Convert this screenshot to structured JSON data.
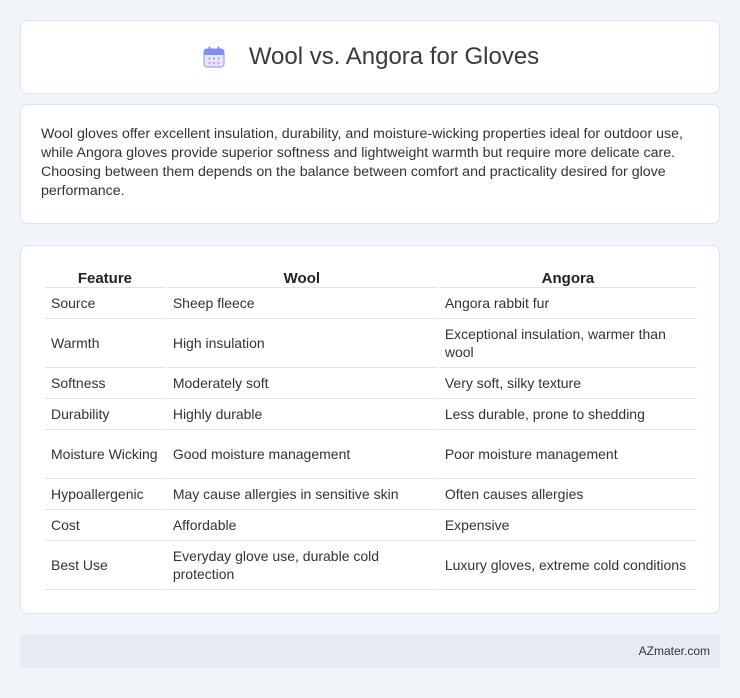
{
  "header": {
    "title": "Wool vs. Angora for Gloves",
    "icon": "calendar-icon"
  },
  "description": "Wool gloves offer excellent insulation, durability, and moisture-wicking properties ideal for outdoor use, while Angora gloves provide superior softness and lightweight warmth but require more delicate care. Choosing between them depends on the balance between comfort and practicality desired for glove performance.",
  "table": {
    "columns": [
      "Feature",
      "Wool",
      "Angora"
    ],
    "rows": [
      [
        "Source",
        "Sheep fleece",
        "Angora rabbit fur"
      ],
      [
        "Warmth",
        "High insulation",
        "Exceptional insulation, warmer than wool"
      ],
      [
        "Softness",
        "Moderately soft",
        "Very soft, silky texture"
      ],
      [
        "Durability",
        "Highly durable",
        "Less durable, prone to shedding"
      ],
      [
        "Moisture Wicking",
        "Good moisture management",
        "Poor moisture management"
      ],
      [
        "Hypoallergenic",
        "May cause allergies in sensitive skin",
        "Often causes allergies"
      ],
      [
        "Cost",
        "Affordable",
        "Expensive"
      ],
      [
        "Best Use",
        "Everyday glove use, durable cold protection",
        "Luxury gloves, extreme cold conditions"
      ]
    ]
  },
  "footer": {
    "brand": "AZmater.com"
  },
  "colors": {
    "background": "#f1f4f9",
    "footer": "#e6ebf6",
    "icon_accent": "#9b8fe6"
  }
}
